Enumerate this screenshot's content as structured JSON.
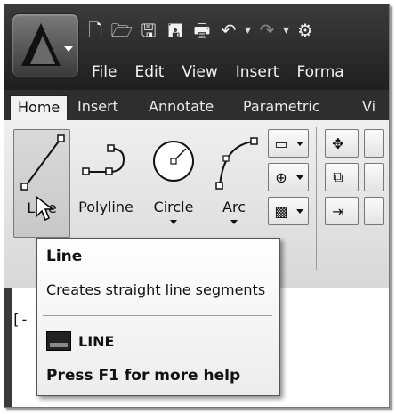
{
  "quick_access": {
    "icons": [
      "new-icon",
      "open-icon",
      "save-icon",
      "saveas-icon",
      "print-icon",
      "undo-icon",
      "redo-icon",
      "workspace-icon"
    ]
  },
  "menubar": {
    "items": [
      "File",
      "Edit",
      "View",
      "Insert",
      "Forma"
    ]
  },
  "ribbon_tabs": {
    "items": [
      "Home",
      "Insert",
      "Annotate",
      "Parametric",
      "Vi"
    ]
  },
  "draw_panel": {
    "buttons": [
      {
        "label": "Line",
        "icon": "line-icon",
        "selected": true
      },
      {
        "label": "Polyline",
        "icon": "polyline-icon"
      },
      {
        "label": "Circle",
        "icon": "circle-icon"
      },
      {
        "label": "Arc",
        "icon": "arc-icon"
      }
    ]
  },
  "command_line": {
    "prompt": "[-"
  },
  "tooltip": {
    "title": "Line",
    "description": "Creates straight line segments",
    "command": "LINE",
    "help": "Press F1 for more help"
  },
  "colors": {
    "dark_chrome": "#2e2e2e",
    "ribbon_bg": "#e6e6e6",
    "tooltip_bg": "#ffffff"
  }
}
